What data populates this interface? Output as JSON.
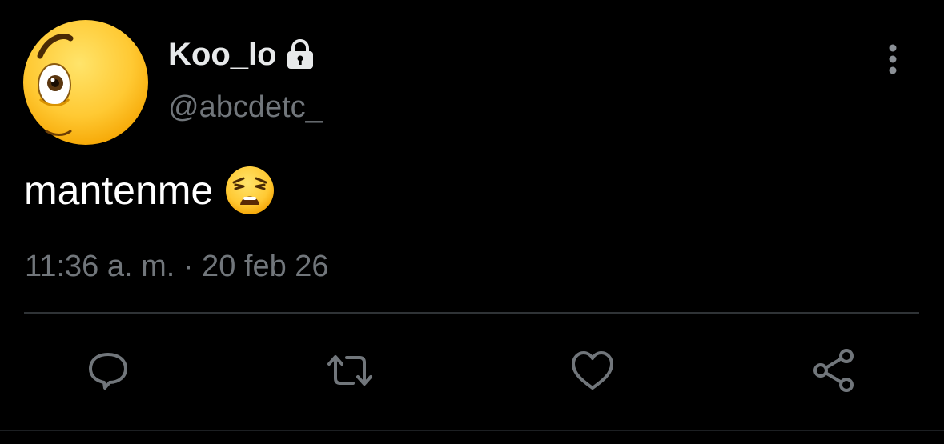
{
  "tweet": {
    "display_name": "Koo_lo",
    "handle": "@abcdetc_",
    "text": "mantenme",
    "timestamp": "11:36 a. m. · 20 feb 26",
    "protected": true
  },
  "actions": [
    {
      "name": "reply",
      "icon": "reply-icon"
    },
    {
      "name": "retweet",
      "icon": "retweet-icon"
    },
    {
      "name": "like",
      "icon": "heart-icon"
    },
    {
      "name": "share",
      "icon": "share-icon"
    }
  ],
  "colors": {
    "background": "#000000",
    "primary_text": "#e7e9ea",
    "secondary_text": "#71767b",
    "icon_gray": "#71767b",
    "divider": "#2f3336",
    "emoji_yellow": "#ffcc33"
  }
}
